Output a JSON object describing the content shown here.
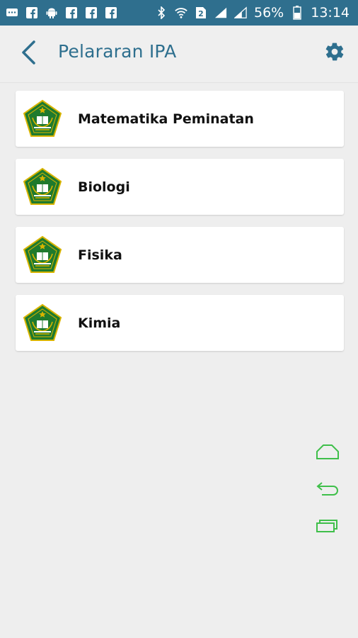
{
  "status_bar": {
    "battery_percent": "56%",
    "time": "13:14",
    "sim_label": "2"
  },
  "app_bar": {
    "title": "Pelararan IPA"
  },
  "subjects": [
    {
      "label": "Matematika Peminatan"
    },
    {
      "label": "Biologi"
    },
    {
      "label": "Fisika"
    },
    {
      "label": "Kimia"
    }
  ],
  "colors": {
    "status_bar": "#2f6f8e",
    "accent": "#2e6f8e",
    "nav_green": "#3fbf4a",
    "emblem_green": "#1f7a2d",
    "emblem_gold": "#d8b400"
  },
  "icons": {
    "back": "back-arrow-icon",
    "settings": "gear-icon",
    "emblem": "kemenag-emblem-icon",
    "home": "home-icon",
    "undo": "back-return-icon",
    "recents": "recent-apps-icon"
  }
}
